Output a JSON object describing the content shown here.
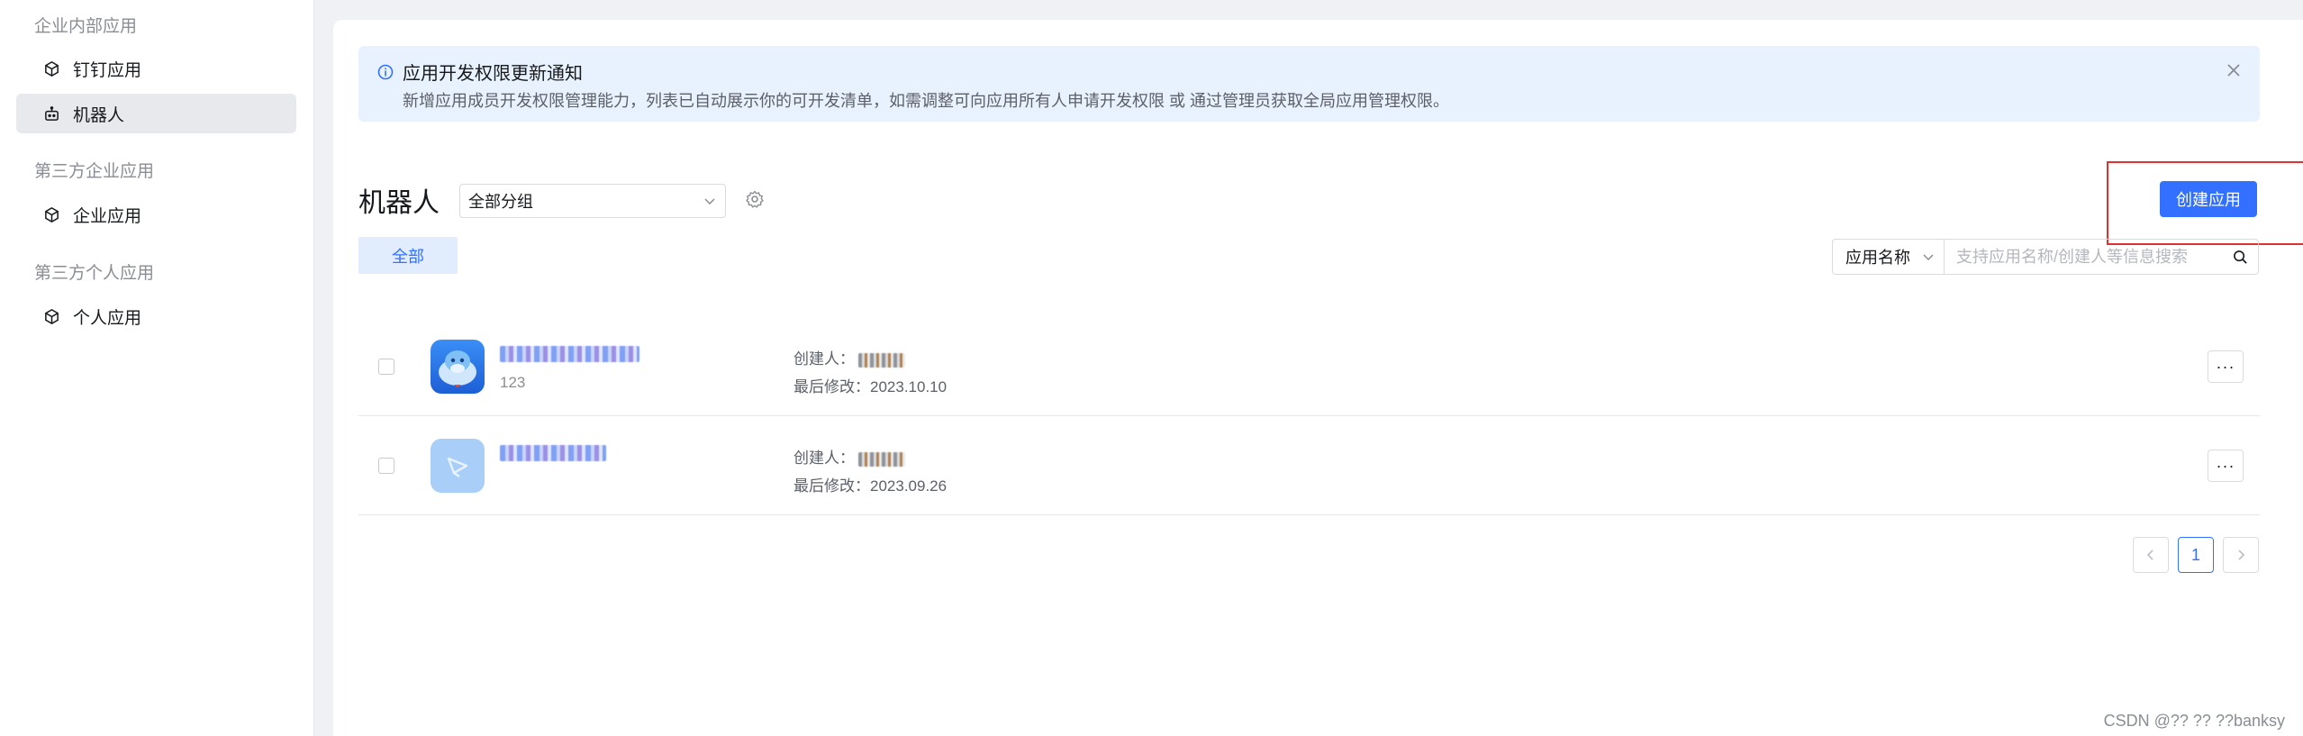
{
  "sidebar": {
    "group_internal": "企业内部应用",
    "item_dingtalk": "钉钉应用",
    "item_robot": "机器人",
    "group_third_party_enterprise": "第三方企业应用",
    "item_enterprise": "企业应用",
    "group_third_party_personal": "第三方个人应用",
    "item_personal": "个人应用"
  },
  "notice": {
    "title": "应用开发权限更新通知",
    "body": "新增应用成员开发权限管理能力，列表已自动展示你的可开发清单，如需调整可向应用所有人申请开发权限 或 通过管理员获取全局应用管理权限。"
  },
  "header": {
    "title": "机器人",
    "group_select_value": "全部分组",
    "create_button": "创建应用"
  },
  "filter": {
    "tab_all": "全部",
    "search_type": "应用名称",
    "search_placeholder": "支持应用名称/创建人等信息搜索"
  },
  "rows": [
    {
      "name": "████████████",
      "desc": "123",
      "creator_label": "创建人：",
      "modified_label": "最后修改：",
      "modified_date": "2023.10.10",
      "more": "···"
    },
    {
      "name": "████████",
      "desc": "",
      "creator_label": "创建人：",
      "modified_label": "最后修改：",
      "modified_date": "2023.09.26",
      "more": "···"
    }
  ],
  "pagination": {
    "current_page": "1"
  },
  "watermark": "CSDN @?? ?? ??banksy",
  "colors": {
    "accent": "#3370ff",
    "notice_bg": "#e8f1fe",
    "highlight_box": "#e03131"
  }
}
